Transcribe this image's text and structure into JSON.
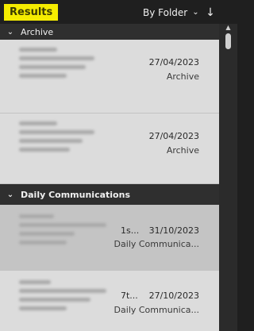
{
  "header": {
    "title": "Results",
    "sort_label": "By Folder",
    "sort_chevron": "chevron-down-icon",
    "sort_direction_icon": "arrow-down-icon"
  },
  "groups": [
    {
      "name": "Archive",
      "items": [
        {
          "date": "27/04/2023",
          "folder": "Archive"
        },
        {
          "date": "27/04/2023",
          "folder": "Archive"
        }
      ]
    },
    {
      "name": "Daily Communications",
      "items": [
        {
          "subject_tail": "1s...",
          "date": "31/10/2023",
          "folder": "Daily Communica..."
        },
        {
          "subject_tail": "7t...",
          "date": "27/10/2023",
          "folder": "Daily Communica..."
        }
      ]
    }
  ],
  "colors": {
    "highlight": "#f5ec00",
    "background": "#1f1f1f",
    "list_background": "#dcdcdc",
    "selected_item": "#c4c4c4"
  }
}
